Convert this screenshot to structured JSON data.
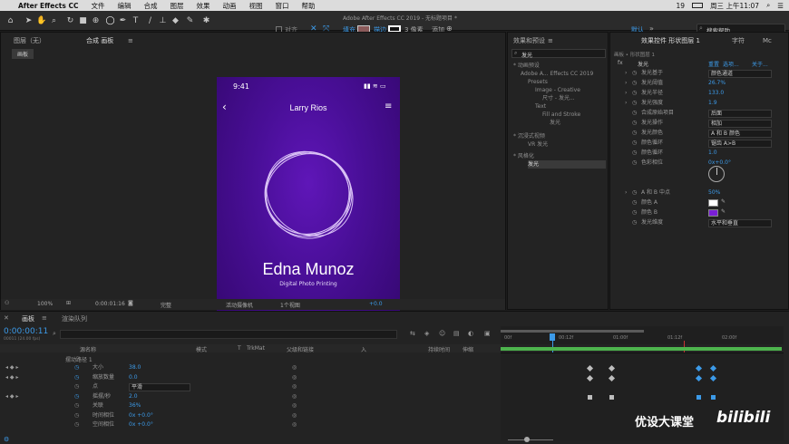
{
  "menubar": {
    "items": [
      "After Effects CC",
      "文件",
      "编辑",
      "合成",
      "图层",
      "效果",
      "动画",
      "视图",
      "窗口",
      "帮助"
    ],
    "title": "Adobe After Effects CC 2019 - 无标题项目 *",
    "battery": "19",
    "clock": "周三 上午11:07"
  },
  "toolbar": {
    "align_label": "对齐",
    "fill_label": "填充",
    "stroke_label": "描边",
    "stroke_px": "3 像素",
    "add_label": "添加",
    "workspace": "默认",
    "search_placeholder": "搜索帮助"
  },
  "project_panel": {
    "tab1": "图层（无）",
    "tab2": "合成 画板",
    "sub_tab": "画板"
  },
  "phone": {
    "time": "9:41",
    "header_title": "Larry Rios",
    "name": "Edna Munoz",
    "subtitle": "Digital Photo Printing"
  },
  "viewer_footer": {
    "zoom": "100%",
    "timecode": "0:00:01:16",
    "quality": "完整",
    "camera": "活动摄像机",
    "views": "1个视图",
    "offset": "+0.0"
  },
  "effects_panel": {
    "title": "效果和预设",
    "search_value": "发光",
    "tree": [
      {
        "label": "* 动画预设",
        "level": 0
      },
      {
        "label": "Adobe A... Effects CC 2019",
        "level": 1
      },
      {
        "label": "Presets",
        "level": 2
      },
      {
        "label": "Image - Creative",
        "level": 3
      },
      {
        "label": "尺寸 - 发光...",
        "level": 4
      },
      {
        "label": "Text",
        "level": 3
      },
      {
        "label": "Fill and Stroke",
        "level": 4
      },
      {
        "label": "发光",
        "level": 5
      },
      {
        "label": "* 沉浸式视频",
        "level": 0
      },
      {
        "label": "VR 发光",
        "level": 2
      },
      {
        "label": "* 风格化",
        "level": 0
      },
      {
        "label": "发光",
        "level": 2
      }
    ]
  },
  "effect_controls": {
    "tab": "效果控件 形状图层 1",
    "tab2": "字符",
    "tab3": "Mc",
    "breadcrumb": "画板 • 形状图层 1",
    "effect_name": "发光",
    "reset": "重置",
    "options": "选项...",
    "about": "关于...",
    "props": [
      {
        "name": "发光基于",
        "value": "颜色通道",
        "kind": "select"
      },
      {
        "name": "发光阈值",
        "value": "26.7%",
        "kind": "num"
      },
      {
        "name": "发光半径",
        "value": "133.0",
        "kind": "num"
      },
      {
        "name": "发光强度",
        "value": "1.9",
        "kind": "num"
      },
      {
        "name": "合成原始项目",
        "value": "后面",
        "kind": "select"
      },
      {
        "name": "发光操作",
        "value": "相加",
        "kind": "select"
      },
      {
        "name": "发光颜色",
        "value": "A 和 B 颜色",
        "kind": "select"
      },
      {
        "name": "颜色循环",
        "value": "锯齿 A>B",
        "kind": "select"
      },
      {
        "name": "颜色循环",
        "value": "1.0",
        "kind": "num"
      },
      {
        "name": "色彩相位",
        "value": "0x+0.0°",
        "kind": "num"
      },
      {
        "name": "A 和 B 中点",
        "value": "50%",
        "kind": "num"
      },
      {
        "name": "颜色 A",
        "value": "",
        "kind": "colorA"
      },
      {
        "name": "颜色 B",
        "value": "",
        "kind": "colorB"
      },
      {
        "name": "发光维度",
        "value": "水平和垂直",
        "kind": "select"
      }
    ],
    "color_a": "#ffffff",
    "color_b": "#7a1fd6"
  },
  "timeline": {
    "tab": "画板",
    "tab2": "渲染队列",
    "timecode": "0:00:00:11",
    "frame_info": "00011 (24.00 fps)",
    "columns": [
      "源名称",
      "模式",
      "T",
      "TrkMat",
      "父级和链接",
      "入",
      "持续时间",
      "伸缩"
    ],
    "ruler": [
      "00f",
      "00:12f",
      "01:00f",
      "01:12f",
      "02:00f"
    ],
    "layer_group": "摆动路径 1",
    "rows": [
      {
        "name": "大小",
        "value": "38.0"
      },
      {
        "name": "缩放数量",
        "value": "0.0"
      },
      {
        "name": "点",
        "value": "平滑"
      },
      {
        "name": "摇摆/秒",
        "value": "2.0"
      },
      {
        "name": "关联",
        "value": "36%"
      },
      {
        "name": "时间相位",
        "value": "0x +0.0°"
      },
      {
        "name": "空间相位",
        "value": "0x +0.0°"
      }
    ]
  },
  "watermark": {
    "text": "优设大课堂",
    "logo": "bilibili"
  }
}
